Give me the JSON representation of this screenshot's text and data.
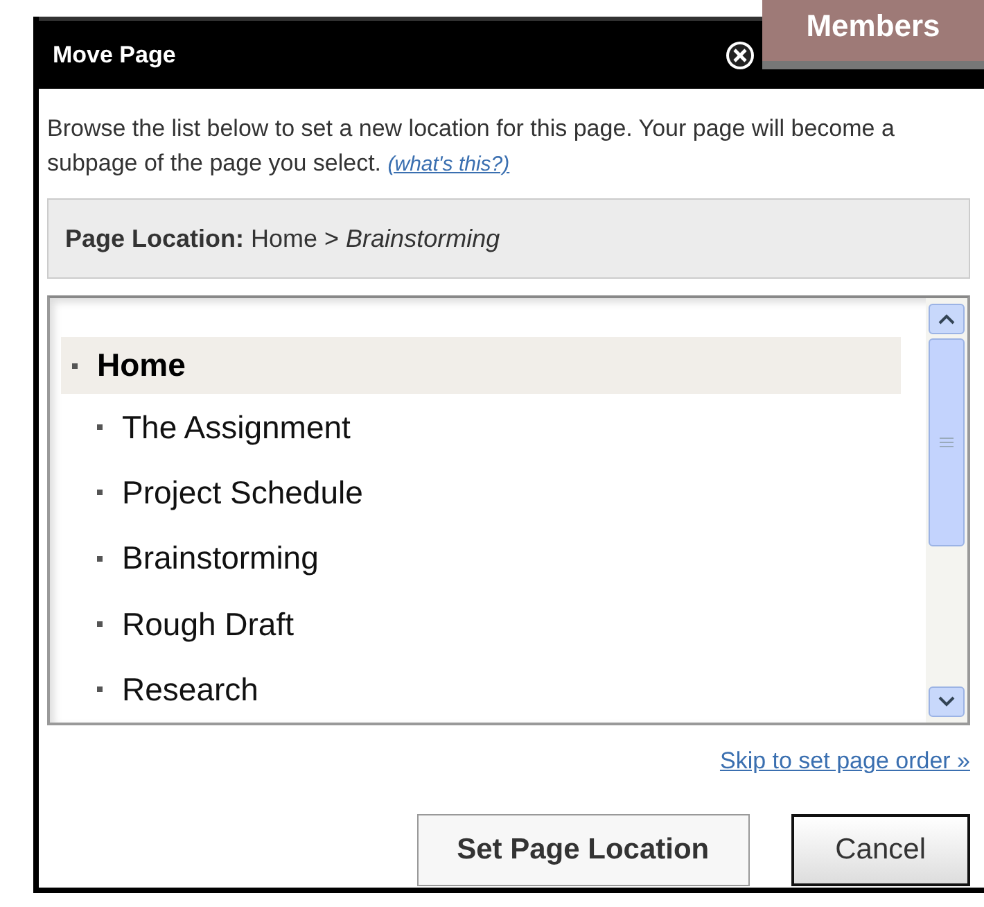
{
  "background_tab": {
    "label": "Members"
  },
  "dialog": {
    "title": "Move Page",
    "intro": "Browse the list below to set a new location for this page. Your page will become a subpage of the page you select.",
    "help_link": "(what's this?)",
    "location_label": "Page Location:",
    "location_path": "Home > *Brainstorming*"
  },
  "tree": [
    {
      "label": "Home",
      "selected": true,
      "children": [
        {
          "label": "The Assignment",
          "selected": false
        },
        {
          "label": "Project Schedule",
          "selected": false
        },
        {
          "label": "Brainstorming",
          "selected": false
        },
        {
          "label": "Rough Draft",
          "selected": false
        },
        {
          "label": "Research",
          "selected": false
        }
      ]
    }
  ],
  "skip_link": "Skip to set page order »",
  "buttons": [
    {
      "label": "Set Page Location",
      "kind": "primary"
    },
    {
      "label": "Cancel",
      "kind": "default"
    }
  ]
}
